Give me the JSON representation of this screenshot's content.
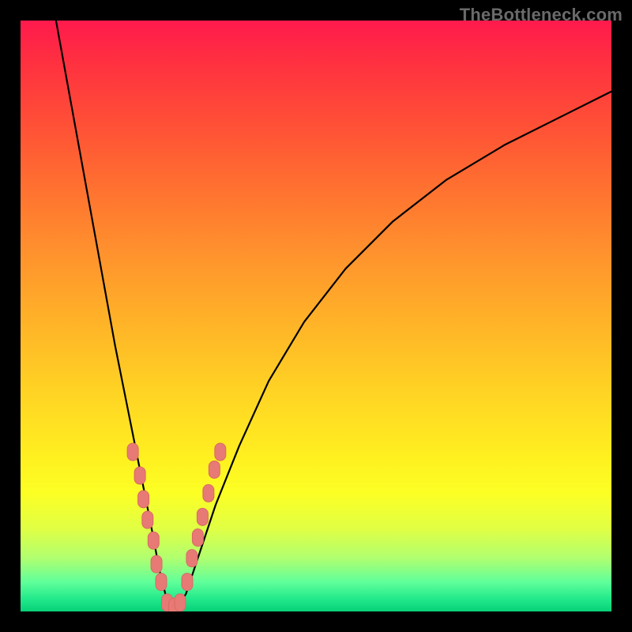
{
  "watermark": "TheBottleneck.com",
  "colors": {
    "page_bg": "#000000",
    "curve": "#000000",
    "marker_fill": "#e77a75",
    "marker_stroke": "#d86a65",
    "gradient_stops": [
      "#ff1a4d",
      "#ff3040",
      "#ff5136",
      "#ff7030",
      "#ff8e2e",
      "#ffb028",
      "#ffd124",
      "#fff020",
      "#fcff24",
      "#e0ff44",
      "#b0ff70",
      "#60ff9a",
      "#20e88a",
      "#08d078"
    ]
  },
  "chart_data": {
    "type": "line",
    "title": "",
    "xlabel": "",
    "ylabel": "",
    "xlim": [
      0,
      100
    ],
    "ylim": [
      0,
      100
    ],
    "grid": false,
    "legend": false,
    "note": "V-shaped bottleneck curve. y is bottleneck % (0=green/optimal, 100=red/severe). Minimum near x≈25. Values estimated from plot geometry; no numeric axis labels shown.",
    "series": [
      {
        "name": "bottleneck-curve",
        "x": [
          6,
          8,
          10,
          12,
          14,
          16,
          18,
          20,
          22,
          23.5,
          25,
          26.5,
          28,
          30,
          33,
          37,
          42,
          48,
          55,
          63,
          72,
          82,
          92,
          100
        ],
        "y": [
          100,
          89,
          78,
          67,
          56,
          45,
          35,
          25,
          15,
          7,
          1,
          0.5,
          3,
          9,
          18,
          28,
          39,
          49,
          58,
          66,
          73,
          79,
          84,
          88
        ]
      }
    ],
    "markers": {
      "name": "highlighted-points",
      "note": "Salmon rounded markers clustered around the trough, mostly in the yellow/green band (y≲27).",
      "shape": "rounded-rect",
      "points": [
        {
          "x": 19.0,
          "y": 27.0
        },
        {
          "x": 20.2,
          "y": 23.0
        },
        {
          "x": 20.8,
          "y": 19.0
        },
        {
          "x": 21.5,
          "y": 15.5
        },
        {
          "x": 22.5,
          "y": 12.0
        },
        {
          "x": 23.0,
          "y": 8.0
        },
        {
          "x": 23.8,
          "y": 5.0
        },
        {
          "x": 24.8,
          "y": 1.5
        },
        {
          "x": 26.0,
          "y": 0.8
        },
        {
          "x": 27.0,
          "y": 1.5
        },
        {
          "x": 28.2,
          "y": 5.0
        },
        {
          "x": 29.0,
          "y": 9.0
        },
        {
          "x": 30.0,
          "y": 12.5
        },
        {
          "x": 30.8,
          "y": 16.0
        },
        {
          "x": 31.8,
          "y": 20.0
        },
        {
          "x": 32.8,
          "y": 24.0
        },
        {
          "x": 33.8,
          "y": 27.0
        }
      ]
    }
  }
}
